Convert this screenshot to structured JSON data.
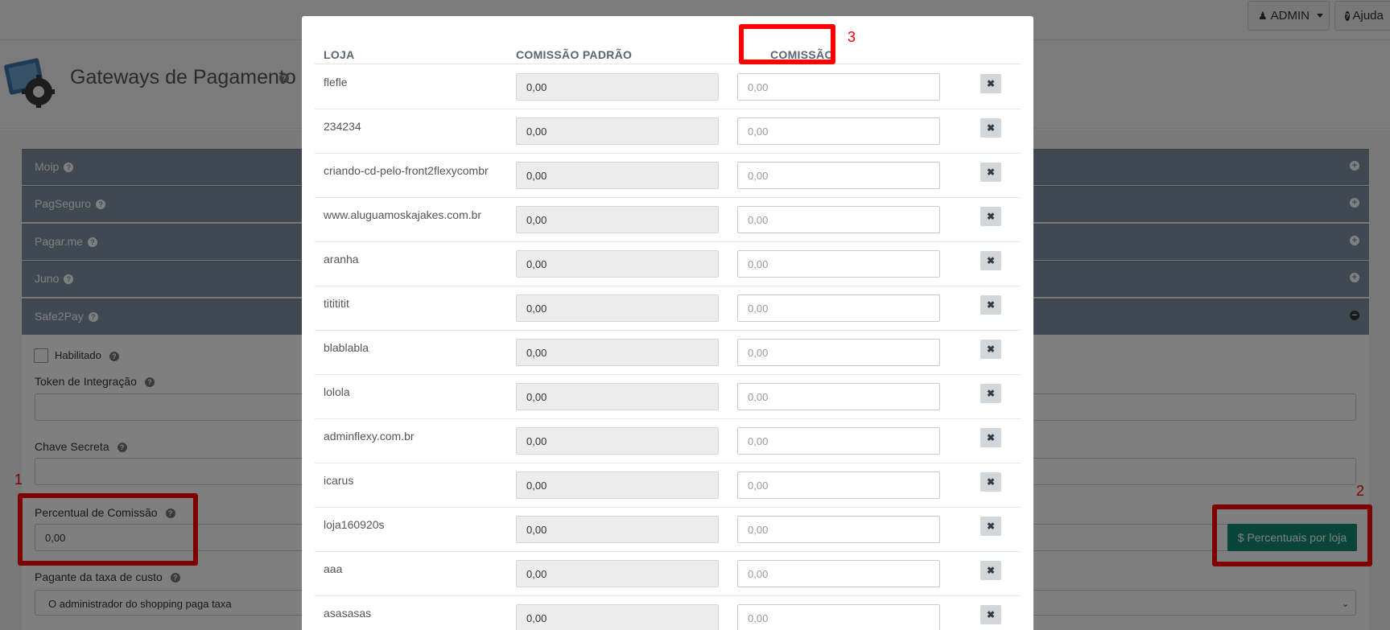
{
  "topbar": {
    "admin_label": "ADMIN",
    "help_label": "Ajuda"
  },
  "page": {
    "title": "Gateways de Pagamento"
  },
  "panels": [
    {
      "label": "Moip",
      "state": "collapsed"
    },
    {
      "label": "PagSeguro",
      "state": "collapsed"
    },
    {
      "label": "Pagar.me",
      "state": "collapsed"
    },
    {
      "label": "Juno",
      "state": "collapsed"
    },
    {
      "label": "Safe2Pay",
      "state": "expanded"
    }
  ],
  "form": {
    "enabled_label": "Habilitado",
    "enabled_checked": false,
    "token_label": "Token de Integração",
    "token_value": "",
    "secret_label": "Chave Secreta",
    "secret_value": "",
    "commission_label": "Percentual de Comissão",
    "commission_value": "0,00",
    "fee_payer_label": "Pagante da taxa de custo",
    "fee_payer_value": "O administrador do shopping paga taxa",
    "per_store_button": "$ Percentuais por loja"
  },
  "annotations": [
    "1",
    "2",
    "3"
  ],
  "modal": {
    "headers": {
      "store": "LOJA",
      "default_commission": "COMISSÃO PADRÃO",
      "commission": "COMISSÃO"
    },
    "rows": [
      {
        "store": "flefle",
        "default": "0,00",
        "placeholder": "0,00"
      },
      {
        "store": "234234",
        "default": "0,00",
        "placeholder": "0,00"
      },
      {
        "store": "criando-cd-pelo-front2flexycombr",
        "default": "0,00",
        "placeholder": "0,00"
      },
      {
        "store": "www.aluguamoskajakes.com.br",
        "default": "0,00",
        "placeholder": "0,00"
      },
      {
        "store": "aranha",
        "default": "0,00",
        "placeholder": "0,00"
      },
      {
        "store": "titititit",
        "default": "0,00",
        "placeholder": "0,00"
      },
      {
        "store": "blablabla",
        "default": "0,00",
        "placeholder": "0,00"
      },
      {
        "store": "lolola",
        "default": "0,00",
        "placeholder": "0,00"
      },
      {
        "store": "adminflexy.com.br",
        "default": "0,00",
        "placeholder": "0,00"
      },
      {
        "store": "icarus",
        "default": "0,00",
        "placeholder": "0,00"
      },
      {
        "store": "loja160920s",
        "default": "0,00",
        "placeholder": "0,00"
      },
      {
        "store": "aaa",
        "default": "0,00",
        "placeholder": "0,00"
      },
      {
        "store": "asasasas",
        "default": "0,00",
        "placeholder": "0,00"
      }
    ]
  },
  "colors": {
    "panel": "#8193a4",
    "accent_button": "#138a77",
    "annotation": "#ff0000"
  }
}
